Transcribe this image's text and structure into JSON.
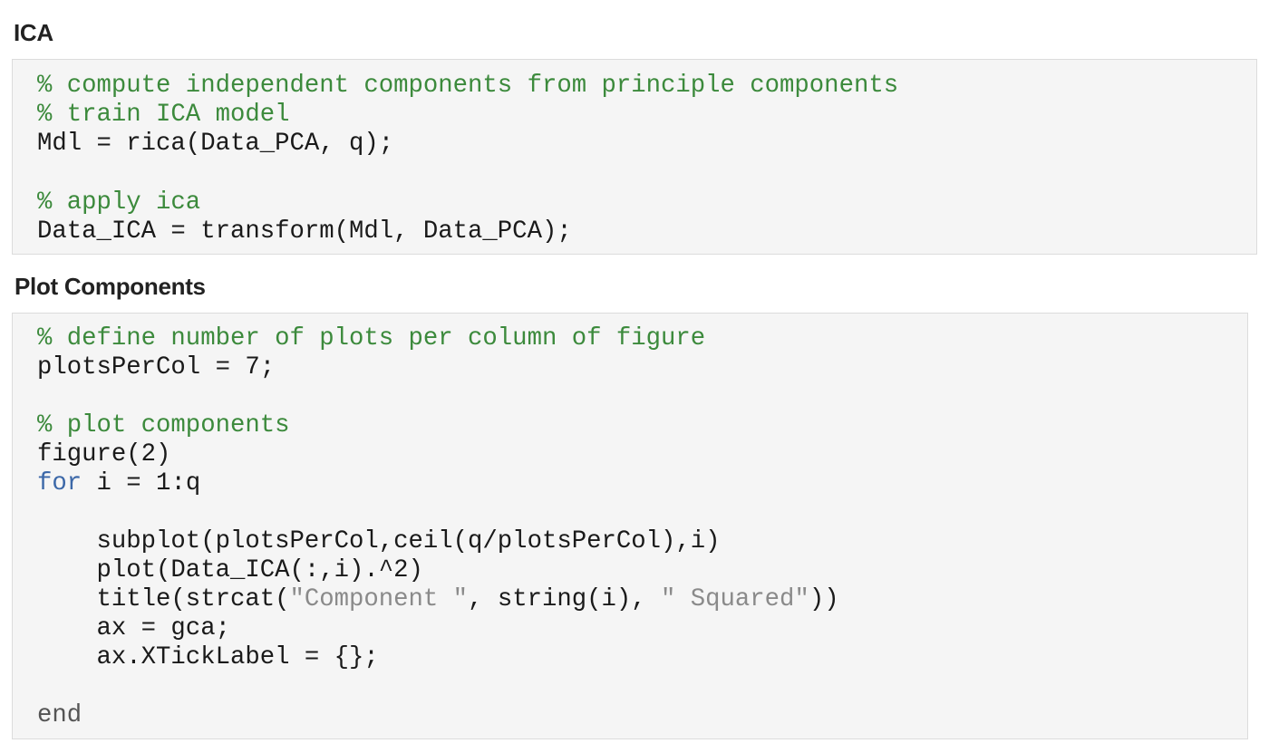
{
  "ica": {
    "heading": "ICA",
    "lines": [
      {
        "kind": "comment",
        "text": "% compute independent components from principle components"
      },
      {
        "kind": "comment",
        "text": "% train ICA model"
      },
      {
        "kind": "code",
        "text": "Mdl = rica(Data_PCA, q);"
      },
      {
        "kind": "blank",
        "text": ""
      },
      {
        "kind": "comment",
        "text": "% apply ica"
      },
      {
        "kind": "code",
        "text": "Data_ICA = transform(Mdl, Data_PCA);"
      }
    ]
  },
  "plot_components": {
    "heading": "Plot Components",
    "line_1": "% define number of plots per column of figure",
    "line_2": "plotsPerCol = 7;",
    "line_4": "% plot components",
    "line_5": "figure(2)",
    "line_6_keyword": "for",
    "line_6_rest": " i = 1:q",
    "line_8": "    subplot(plotsPerCol,ceil(q/plotsPerCol),i)",
    "line_9": "    plot(Data_ICA(:,i).^2)",
    "line_10_a": "    title(strcat(",
    "line_10_str1": "\"Component \"",
    "line_10_b": ", string(i), ",
    "line_10_str2": "\" Squared\"",
    "line_10_c": "))",
    "line_11": "    ax = gca;",
    "line_12": "    ax.XTickLabel = {};",
    "line_14": "end"
  },
  "colors": {
    "comment": "#3c8a3c",
    "keyword": "#3c68a8",
    "string": "#8a8a8a",
    "code": "#1a1a1a",
    "block_background": "#f5f5f5",
    "block_border": "#dcdcdc"
  }
}
